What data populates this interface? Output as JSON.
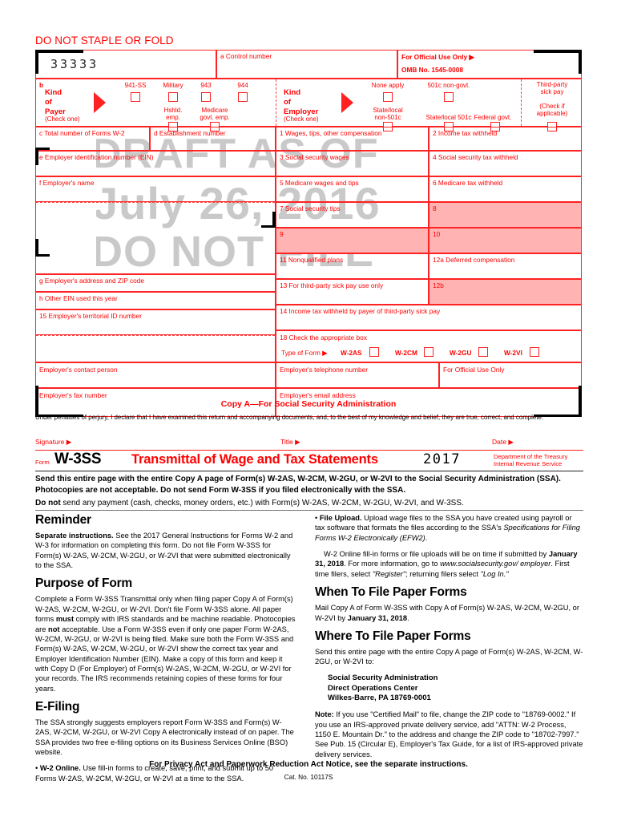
{
  "document": {
    "do_not_staple": "DO NOT STAPLE OR FOLD",
    "copy_a": "Copy A—For Social Security Administration",
    "perjury": "Under penalties of perjury, I declare that I have examined this return and accompanying documents, and, to the best of my knowledge and belief, they are true, correct, and complete.",
    "cat_no": "Cat. No. 10117S",
    "privacy_notice": "For Privacy Act and Paperwork Reduction Act Notice, see the separate instructions."
  },
  "watermark": {
    "line1": "DRAFT AS OF",
    "line2": "July 26, 2016",
    "line3": "DO NOT FILE"
  },
  "form_grid": {
    "control_number_value": "33333",
    "a_control_number": "a  Control number",
    "official_use_only": "For Official Use Only ▶",
    "omb": "OMB No. 1545-0008",
    "b_marker": "b",
    "kind_of_payer": [
      "Kind",
      "of",
      "Payer"
    ],
    "kind_of_payer_check": "(Check one)",
    "payer_options_top": [
      "941-SS",
      "Military",
      "943",
      "944"
    ],
    "payer_options_bottom": [
      "Hshld.\nemp.",
      "Medicare\ngovt. emp."
    ],
    "payer_hshld_line1": "Hshld.",
    "payer_hshld_line2": "emp.",
    "payer_medicare_line1": "Medicare",
    "payer_medicare_line2": "govt. emp.",
    "kind_of_employer": [
      "Kind",
      "of",
      "Employer"
    ],
    "kind_of_employer_check": "(Check one)",
    "employer_opt_none": "None apply",
    "employer_opt_501c": "501c non-govt.",
    "employer_opt_state_nonline1": "State/local",
    "employer_opt_state_nonline2": "non-501c",
    "employer_opt_state_501c": "State/local 501c",
    "employer_opt_federal": "Federal govt.",
    "third_party_line1": "Third-party",
    "third_party_line2": "sick pay",
    "third_party_line3": "(Check if",
    "third_party_line4": "applicable)",
    "c_total_forms": "c Total number of Forms W-2",
    "d_establishment": "d Establishment number",
    "e_ein": "e Employer identification number (EIN)",
    "f_employer_name": "f  Employer's name",
    "g_address": "g Employer's address and ZIP code",
    "h_other_ein": "h Other EIN used this year",
    "box15": "15 Employer's territorial ID number",
    "box1": "1 Wages, tips, other compensation",
    "box2": "2 Income tax withheld",
    "box3": "3 Social security wages",
    "box4": "4 Social security tax withheld",
    "box5": "5 Medicare wages and tips",
    "box6": "6 Medicare tax withheld",
    "box7": "7 Social security tips",
    "box8": "8",
    "box9": "9",
    "box10": "10",
    "box11": "11 Nonqualified plans",
    "box12a": "12a Deferred compensation",
    "box12b": "12b",
    "box13": "13 For third-party sick pay use only",
    "box14": "14 Income tax withheld by payer of third-party sick pay",
    "box18": "18 Check the appropriate box",
    "type_of_form": "Type of Form ▶",
    "form_types": [
      "W-2AS",
      "W-2CM",
      "W-2GU",
      "W-2VI"
    ],
    "contact_person": "Employer's contact person",
    "telephone_number": "Employer's telephone number",
    "official_use_only_2": "For Official Use Only",
    "fax_number": "Employer's fax number",
    "email_address": "Employer's email address"
  },
  "signature_row": {
    "signature": "Signature ▶",
    "title": "Title ▶",
    "date": "Date ▶"
  },
  "title_row": {
    "form_label": "Form",
    "form_number": "W-3SS",
    "form_title": "Transmittal of Wage and Tax Statements",
    "tax_year": "2017",
    "dept_line1": "Department of the Treasury",
    "dept_line2": "Internal Revenue Service"
  },
  "send_block": {
    "line1": "Send this entire page with the entire Copy A page of Form(s) W-2AS, W-2CM, W-2GU, or W-2VI to the Social Security Administration (SSA). Photocopies are not acceptable. Do not send Form W-3SS if you filed electronically with the SSA.",
    "line2_bold": "Do not",
    "line2_rest": " send any payment (cash, checks, money orders, etc.) with Form(s) W-2AS, W-2CM, W-2GU, W-2VI, and W-3SS."
  },
  "left_column": {
    "reminder_heading": "Reminder",
    "reminder_bold": "Separate instructions.",
    "reminder_text": " See the 2017 General Instructions for Forms W-2 and W-3 for information on completing this form. Do not file Form W-3SS for Form(s) W-2AS, W-2CM, W-2GU, or W-2VI that were submitted electronically to the SSA.",
    "purpose_heading": "Purpose of Form",
    "purpose_p1_a": "Complete a Form W-3SS Transmittal only when filing paper Copy A of Form(s) W-2AS, W-2CM, W-2GU, or W-2VI. Don't file Form W-3SS alone. All paper forms ",
    "purpose_must": "must",
    "purpose_p1_b": " comply with IRS standards and be machine readable. Photocopies are ",
    "purpose_not": "not",
    "purpose_p1_c": " acceptable. Use a Form W-3SS even if only one paper Form W-2AS, W-2CM, W-2GU, or W-2VI is being filed. Make sure both the Form W-3SS and Form(s) W-2AS, W-2CM, W-2GU, or W-2VI show the correct tax year and Employer Identification Number (EIN). Make a copy of this form and keep it with Copy D (For Employer) of Form(s) W-2AS, W-2CM, W-2GU, or W-2VI for your records. The IRS recommends retaining copies of these forms for four years.",
    "efiling_heading": "E-Filing",
    "efiling_p1": "The SSA strongly suggests employers report Form W-3SS and Form(s) W-2AS, W-2CM, W-2GU, or W-2VI Copy A electronically instead of on paper. The SSA provides two free e-filing options on its Business Services Online (BSO) website.",
    "w2_online_bullet": "• ",
    "w2_online_bold": "W-2 Online.",
    "w2_online_text": " Use fill-in forms to create, save, print, and submit up to 50 Forms W-2AS, W-2CM, W-2GU, or W-2VI at a time to the SSA."
  },
  "right_column": {
    "file_upload_bullet": "• ",
    "file_upload_bold": "File Upload.",
    "file_upload_text_a": " Upload wage files to the SSA you have created using payroll or tax software that formats the files according to the SSA's ",
    "file_upload_italic": "Specifications for Filing Forms W-2 Electronically (EFW2)",
    "file_upload_text_b": ".",
    "w2_online_p_a": "W-2 Online fill-in forms or file uploads will be on time if submitted by ",
    "w2_online_p_date": "January 31, 2018",
    "w2_online_p_b": ". For more information, go to ",
    "w2_online_p_url": "www.socialsecurity.gov/ employer",
    "w2_online_p_c": ". First time filers, select ",
    "w2_online_p_register": "\"Register\"",
    "w2_online_p_d": "; returning filers select ",
    "w2_online_p_login": "\"Log In.\"",
    "when_heading": "When To File Paper Forms",
    "when_text_a": "Mail Copy A of Form W-3SS with Copy A of Form(s) W-2AS, W-2CM, W-2GU, or W-2VI by ",
    "when_text_date": "January 31, 2018",
    "when_text_b": ".",
    "where_heading": "Where To File Paper Forms",
    "where_text": "Send this entire page with the entire Copy A page of Form(s) W-2AS, W-2CM, W-2GU, or W-2VI to:",
    "address_line1": "Social Security Administration",
    "address_line2": "Direct Operations Center",
    "address_line3": "Wilkes-Barre, PA 18769-0001",
    "note_bold": "Note:",
    "note_text": "  If you use \"Certified Mail\" to file, change the ZIP code to \"18769-0002.\" If you use an IRS-approved private delivery service, add \"ATTN: W-2 Process, 1150 E. Mountain Dr.\" to the address and change the ZIP code to \"18702-7997.\" See Pub. 15 (Circular E), Employer's Tax Guide, for a list of IRS-approved private delivery services."
  },
  "colors": {
    "form_red": "#ff2222",
    "shade_pink": "#ffb3b3",
    "watermark_gray": "#c9c9c9"
  }
}
